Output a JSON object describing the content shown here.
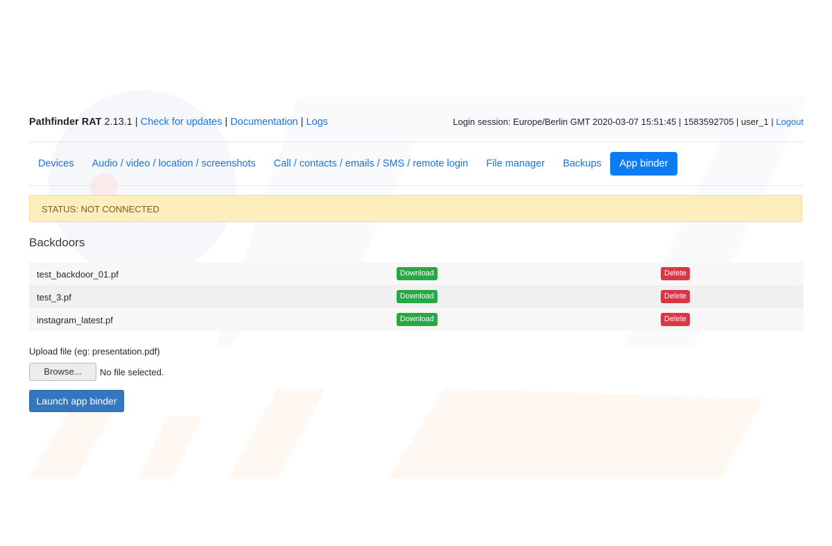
{
  "header": {
    "app_name": "Pathfinder RAT",
    "version": "2.13.1",
    "separator": "|",
    "links": [
      "Check for updates",
      "Documentation",
      "Logs"
    ],
    "session_text": "Login session: Europe/Berlin GMT 2020-03-07 15:51:45 | 1583592705 | user_1 |",
    "logout_label": "Logout"
  },
  "nav": {
    "tabs": [
      "Devices",
      "Audio / video / location / screenshots",
      "Call / contacts / emails / SMS / remote login",
      "File manager",
      "Backups",
      "App binder"
    ],
    "active": "App binder"
  },
  "status": {
    "text": "STATUS: NOT CONNECTED"
  },
  "backdoors": {
    "title": "Backdoors",
    "download_label": "Download",
    "delete_label": "Delete",
    "files": [
      "test_backdoor_01.pf",
      "test_3.pf",
      "instagram_latest.pf"
    ]
  },
  "upload": {
    "label": "Upload file (eg: presentation.pdf)",
    "browse_label": "Browse...",
    "no_file_text": "No file selected."
  },
  "launch": {
    "label": "Launch app binder"
  },
  "colors": {
    "link": "#1a73e8",
    "active_tab": "#0d7cf2",
    "download": "#28a745",
    "delete": "#dc3545",
    "alert_bg": "#fcefbd",
    "launch": "#3477be"
  }
}
